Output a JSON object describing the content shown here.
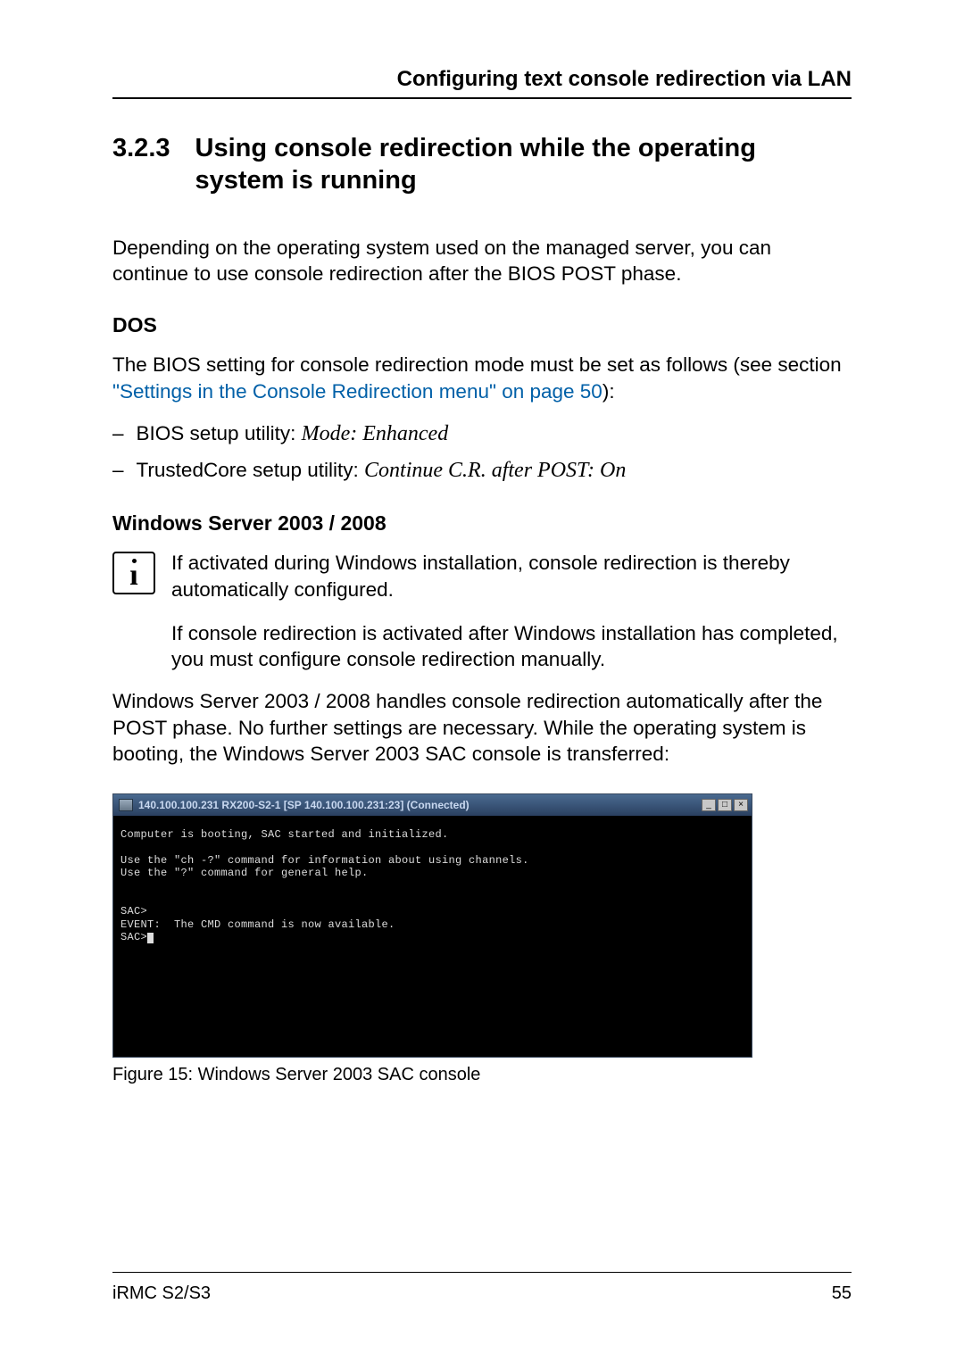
{
  "header": {
    "running_title": "Configuring text console redirection via LAN"
  },
  "section": {
    "number": "3.2.3",
    "title": "Using console redirection while the operating system is running"
  },
  "intro_para": "Depending on the operating system used on the managed server, you can continue to use console redirection after the BIOS POST phase.",
  "dos": {
    "heading": "DOS",
    "para_prefix": "The BIOS setting for console redirection mode must be set as follows (see section ",
    "link_text": "\"Settings in the Console Redirection menu\" on page 50",
    "para_suffix": "):",
    "bullets": [
      {
        "prefix": "BIOS setup utility: ",
        "italic": "Mode: Enhanced"
      },
      {
        "prefix": "TrustedCore setup utility: ",
        "italic": "Continue C.R. after POST: On"
      }
    ]
  },
  "win": {
    "heading": "Windows Server 2003 / 2008",
    "info_p1": "If activated during Windows installation, console redirection is thereby automatically configured.",
    "info_p2": "If console redirection is activated after Windows installation has completed, you must configure console redirection manually.",
    "body_para": "Windows Server 2003 / 2008 handles console redirection automatically after the POST phase. No further settings are necessary. While the operating system is booting, the Windows  Server 2003 SAC console is transferred:"
  },
  "console": {
    "title": "140.100.100.231  RX200-S2-1 [SP 140.100.100.231:23]  (Connected)",
    "min_label": "_",
    "max_label": "□",
    "close_label": "×",
    "line1": "Computer is booting, SAC started and initialized.",
    "line2": "Use the \"ch -?\" command for information about using channels.",
    "line3": "Use the \"?\" command for general help.",
    "prompt1": "SAC>",
    "event": "EVENT:  The CMD command is now available.",
    "prompt2": "SAC>"
  },
  "figure_caption": "Figure 15: Windows Server 2003 SAC console",
  "footer": {
    "left": "iRMC S2/S3",
    "right": "55"
  }
}
